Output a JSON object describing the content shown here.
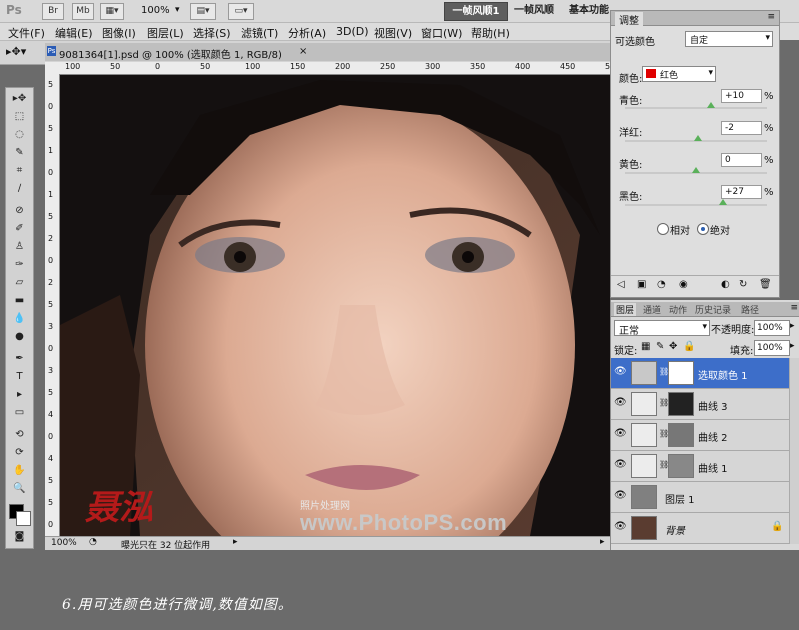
{
  "titlebar": {
    "app": "Ps",
    "br": "Br",
    "mb": "Mb",
    "zoom": "100%",
    "workspace_active": "一帧风顺1",
    "workspace_2": "一帧风顺",
    "workspace_3": "基本功能"
  },
  "menu": [
    "文件(F)",
    "编辑(E)",
    "图像(I)",
    "图层(L)",
    "选择(S)",
    "滤镜(T)",
    "分析(A)",
    "3D(D)",
    "视图(V)",
    "窗口(W)",
    "帮助(H)"
  ],
  "document": {
    "tab_title": "9081364[1].psd @ 100% (选取颜色 1, RGB/8)",
    "close": "×",
    "ruler_top": [
      "100",
      "50",
      "0",
      "50",
      "100",
      "150",
      "200",
      "250",
      "300",
      "350",
      "400",
      "450",
      "500"
    ],
    "ruler_left": [
      "5",
      "0",
      "5",
      "1",
      "0",
      "1",
      "5",
      "2",
      "0",
      "2",
      "5",
      "3",
      "0",
      "3",
      "5",
      "4",
      "0",
      "4",
      "5",
      "5",
      "0"
    ],
    "status_zoom": "100%",
    "status_text": "曝光只在 32 位起作用",
    "watermark_cn": "照片处理网",
    "watermark_url": "www.PhotoPS.com",
    "signature": "聂泓"
  },
  "adjustments": {
    "tab": "调整",
    "title": "可选颜色",
    "preset": "自定",
    "color_label": "颜色:",
    "color_value": "红色",
    "rows": [
      {
        "label": "青色:",
        "value": "+10",
        "unit": "%"
      },
      {
        "label": "洋红:",
        "value": "-2",
        "unit": "%"
      },
      {
        "label": "黄色:",
        "value": "0",
        "unit": "%"
      },
      {
        "label": "黑色:",
        "value": "+27",
        "unit": "%"
      }
    ],
    "method_relative": "相对",
    "method_absolute": "绝对",
    "accent": "#5ab05a"
  },
  "layers": {
    "tabs": [
      "图层",
      "通道",
      "动作",
      "历史记录",
      "路径"
    ],
    "blend_mode": "正常",
    "opacity_label": "不透明度:",
    "opacity_value": "100%",
    "lock_label": "锁定:",
    "fill_label": "填充:",
    "fill_value": "100%",
    "items": [
      {
        "name": "选取颜色 1",
        "selected": true
      },
      {
        "name": "曲线 3",
        "selected": false
      },
      {
        "name": "曲线 2",
        "selected": false
      },
      {
        "name": "曲线 1",
        "selected": false
      },
      {
        "name": "图层 1",
        "selected": false
      },
      {
        "name": "背景",
        "selected": false
      }
    ],
    "selected_color": "#3d6ec9"
  },
  "caption": "6.用可选颜色进行微调,数值如图。"
}
